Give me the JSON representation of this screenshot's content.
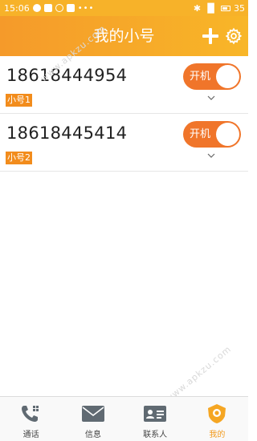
{
  "status_bar": {
    "time": "15:06",
    "signal": "▐▌",
    "battery_level": "35"
  },
  "header": {
    "title": "我的小号"
  },
  "numbers": [
    {
      "number": "18618444954",
      "tag": "小号1",
      "switch_label": "开机"
    },
    {
      "number": "18618445414",
      "tag": "小号2",
      "switch_label": "开机"
    }
  ],
  "bottom_nav": [
    {
      "label": "通话",
      "icon": "phone-icon"
    },
    {
      "label": "信息",
      "icon": "message-icon"
    },
    {
      "label": "联系人",
      "icon": "contact-card-icon"
    },
    {
      "label": "我的",
      "icon": "profile-badge-icon",
      "active": true
    }
  ],
  "watermark": "www.apkzu.com",
  "colors": {
    "accent": "#f0752a",
    "header_start": "#f59a2a",
    "header_end": "#f8b628",
    "tag": "#f28c1c"
  }
}
